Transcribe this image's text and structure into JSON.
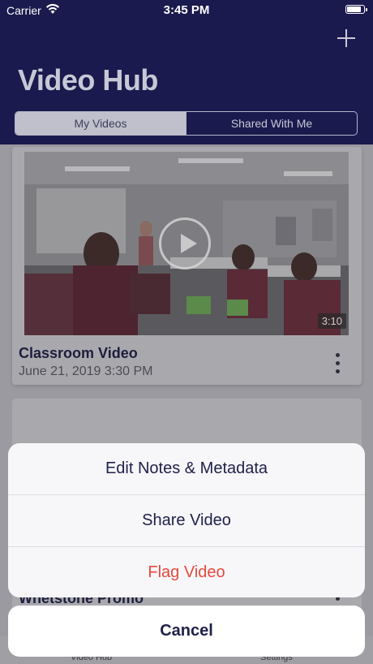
{
  "status_bar": {
    "carrier": "Carrier",
    "time": "3:45 PM"
  },
  "header": {
    "title": "Video Hub",
    "add_icon": "plus-icon",
    "segments": [
      "My Videos",
      "Shared With Me"
    ],
    "selected_segment": "My Videos"
  },
  "videos": [
    {
      "title": "Classroom Video",
      "date": "June 21, 2019 3:30 PM",
      "duration": "3:10"
    },
    {
      "title": "Whetstone Promo"
    }
  ],
  "tab_bar": {
    "items": [
      "Video Hub",
      "Settings"
    ]
  },
  "action_sheet": {
    "actions": [
      "Edit Notes & Metadata",
      "Share Video",
      "Flag Video"
    ],
    "cancel": "Cancel",
    "destructive_color": "#e5493d"
  },
  "colors": {
    "header_bg": "#1a1a4e",
    "accent": "#20204a"
  }
}
